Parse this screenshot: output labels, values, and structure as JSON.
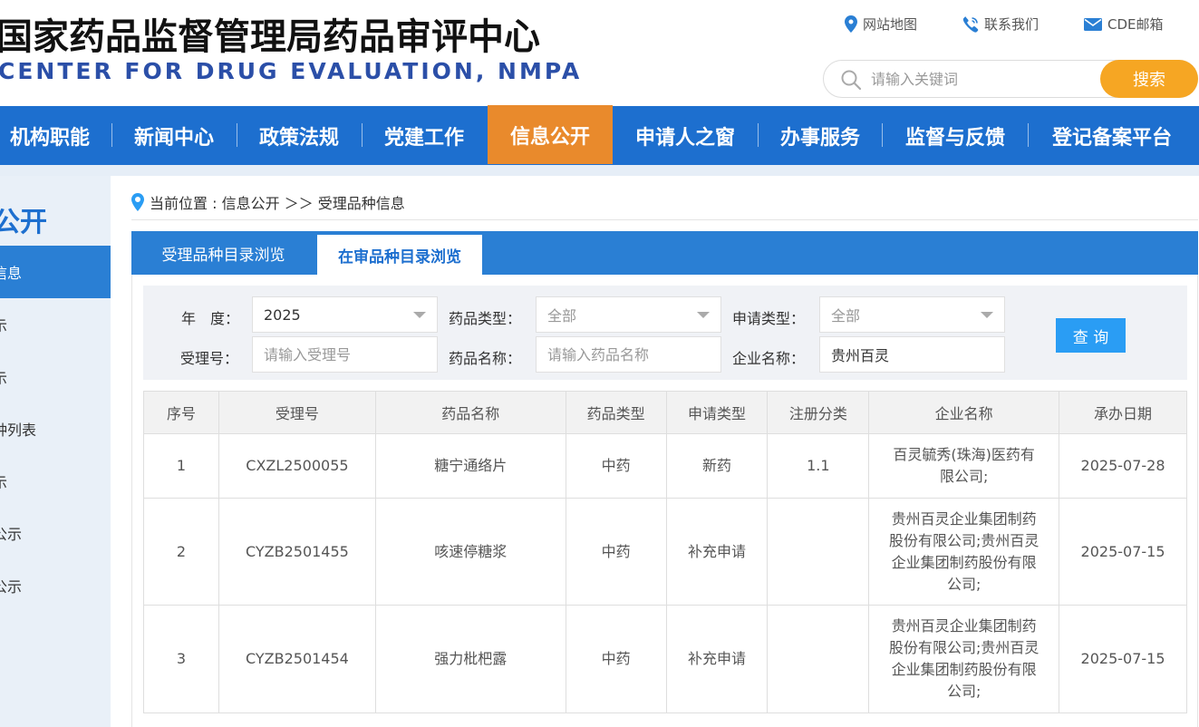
{
  "header": {
    "title_cn": "国家药品监督管理局药品审评中心",
    "title_en": "CENTER FOR DRUG EVALUATION, NMPA",
    "links": [
      {
        "label": "网站地图",
        "icon": "location-pin-icon"
      },
      {
        "label": "联系我们",
        "icon": "phone-icon"
      },
      {
        "label": "CDE邮箱",
        "icon": "mail-icon"
      }
    ],
    "search": {
      "placeholder": "请输入关键词",
      "button": "搜索"
    }
  },
  "nav": {
    "items": [
      "机构职能",
      "新闻中心",
      "政策法规",
      "党建工作",
      "信息公开",
      "申请人之窗",
      "办事服务",
      "监督与反馈",
      "登记备案平台"
    ],
    "active": "信息公开"
  },
  "sidebar": {
    "title": "公开",
    "items": [
      "信息",
      "示",
      "示",
      "种列表",
      "示",
      "公示",
      "公示"
    ],
    "active_index": 0
  },
  "breadcrumb": {
    "text": "当前位置 : 信息公开 ＞＞ 受理品种信息"
  },
  "tabs": {
    "items": [
      "受理品种目录浏览",
      "在审品种目录浏览"
    ],
    "active_index": 1
  },
  "filters": {
    "year_label": "年　度：",
    "year_value": "2025",
    "drug_type_label": "药品类型：",
    "drug_type_value": "全部",
    "apply_type_label": "申请类型：",
    "apply_type_value": "全部",
    "accept_no_label": "受理号：",
    "accept_no_placeholder": "请输入受理号",
    "drug_name_label": "药品名称：",
    "drug_name_placeholder": "请输入药品名称",
    "company_label": "企业名称：",
    "company_value": "贵州百灵",
    "query_button": "查 询"
  },
  "table": {
    "headers": [
      "序号",
      "受理号",
      "药品名称",
      "药品类型",
      "申请类型",
      "注册分类",
      "企业名称",
      "承办日期"
    ],
    "rows": [
      {
        "no": "1",
        "accept_no": "CXZL2500055",
        "drug_name": "糖宁通络片",
        "drug_type": "中药",
        "apply_type": "新药",
        "reg_class": "1.1",
        "company_lines": [
          "百灵毓秀(珠海)医药有",
          "限公司;"
        ],
        "date": "2025-07-28"
      },
      {
        "no": "2",
        "accept_no": "CYZB2501455",
        "drug_name": "咳速停糖浆",
        "drug_type": "中药",
        "apply_type": "补充申请",
        "reg_class": "",
        "company_lines": [
          "贵州百灵企业集团制药",
          "股份有限公司;贵州百灵",
          "企业集团制药股份有限",
          "公司;"
        ],
        "date": "2025-07-15"
      },
      {
        "no": "3",
        "accept_no": "CYZB2501454",
        "drug_name": "强力枇杷露",
        "drug_type": "中药",
        "apply_type": "补充申请",
        "reg_class": "",
        "company_lines": [
          "贵州百灵企业集团制药",
          "股份有限公司;贵州百灵",
          "企业集团制药股份有限",
          "公司;"
        ],
        "date": "2025-07-15"
      }
    ]
  },
  "colors": {
    "nav_bg": "#1d6fcf",
    "nav_active": "#e98a2c",
    "search_btn": "#f6a623",
    "tab_bar": "#2a7fd4",
    "query_btn": "#2a9df4",
    "title_en": "#2b4fa8"
  }
}
